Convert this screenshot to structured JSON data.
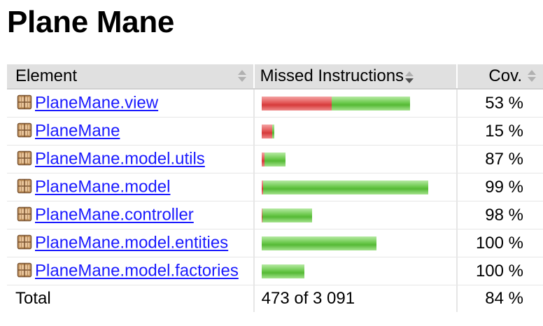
{
  "page": {
    "title": "Plane Mane"
  },
  "table": {
    "headers": {
      "element": "Element",
      "missed": "Missed Instructions",
      "cov": "Cov."
    },
    "sort": {
      "column": "missed",
      "direction": "descending"
    },
    "icon_name": "package-icon",
    "colors": {
      "link": "#1a1aff",
      "missed_bar": "#e25656",
      "covered_bar": "#6bc94c",
      "header_bg": "#e0e0e0"
    },
    "rows": [
      {
        "element": "PlaneMane.view",
        "cov": "53 %",
        "missed_fraction": 0.47,
        "bar_total_fraction": 0.664
      },
      {
        "element": "PlaneMane",
        "cov": "15 %",
        "missed_fraction": 0.85,
        "bar_total_fraction": 0.057
      },
      {
        "element": "PlaneMane.model.utils",
        "cov": "87 %",
        "missed_fraction": 0.13,
        "bar_total_fraction": 0.107
      },
      {
        "element": "PlaneMane.model",
        "cov": "99 %",
        "missed_fraction": 0.01,
        "bar_total_fraction": 0.745
      },
      {
        "element": "PlaneMane.controller",
        "cov": "98 %",
        "missed_fraction": 0.02,
        "bar_total_fraction": 0.226
      },
      {
        "element": "PlaneMane.model.entities",
        "cov": "100 %",
        "missed_fraction": 0.0,
        "bar_total_fraction": 0.513
      },
      {
        "element": "PlaneMane.model.factories",
        "cov": "100 %",
        "missed_fraction": 0.0,
        "bar_total_fraction": 0.19
      }
    ],
    "total": {
      "label": "Total",
      "missed": "473 of 3 091",
      "cov": "84 %"
    }
  }
}
